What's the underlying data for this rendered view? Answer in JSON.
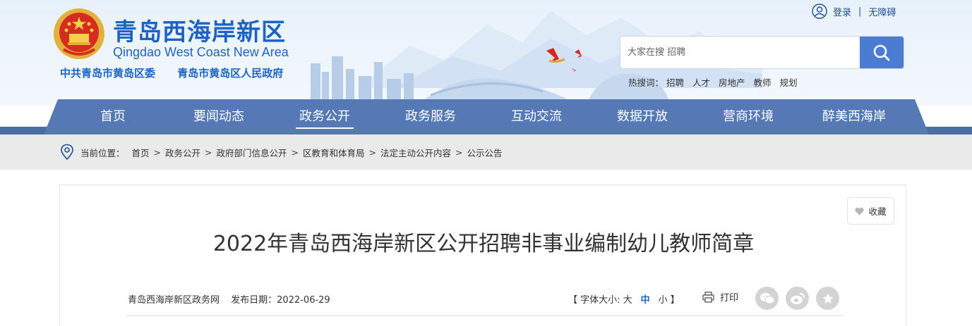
{
  "header": {
    "site_title": "青岛西海岸新区",
    "site_subtitle": "Qingdao West Coast New Area",
    "org_links": [
      "中共青岛市黄岛区委",
      "青岛市黄岛区人民政府"
    ],
    "user_links": {
      "login": "登录",
      "separator": "|",
      "accessibility": "无障碍"
    },
    "search": {
      "placeholder": "大家在搜 招聘"
    },
    "hot_words": {
      "label": "热搜词：",
      "items": [
        "招聘",
        "人才",
        "房地产",
        "教师",
        "规划"
      ]
    }
  },
  "nav": {
    "items": [
      "首页",
      "要闻动态",
      "政务公开",
      "政务服务",
      "互动交流",
      "数据开放",
      "营商环境",
      "醉美西海岸"
    ],
    "active": "政务公开"
  },
  "breadcrumb": {
    "label": "当前位置：",
    "items": [
      "首页",
      "政务公开",
      "政府部门信息公开",
      "区教育和体育局",
      "法定主动公开内容",
      "公示公告"
    ]
  },
  "article": {
    "favorite_label": "收藏",
    "title": "2022年青岛西海岸新区公开招聘非事业编制幼儿教师简章",
    "source": "青岛西海岸新区政务网",
    "date_label": "发布日期：2022-06-29",
    "font_size_label": "【 字体大小: 大",
    "font_mid": "中",
    "font_small": "小 】",
    "print_label": "打印"
  },
  "colors": {
    "brand": "#1d63c4",
    "nav": "#5479b5",
    "breadcrumb_bg": "#eaeaea"
  }
}
